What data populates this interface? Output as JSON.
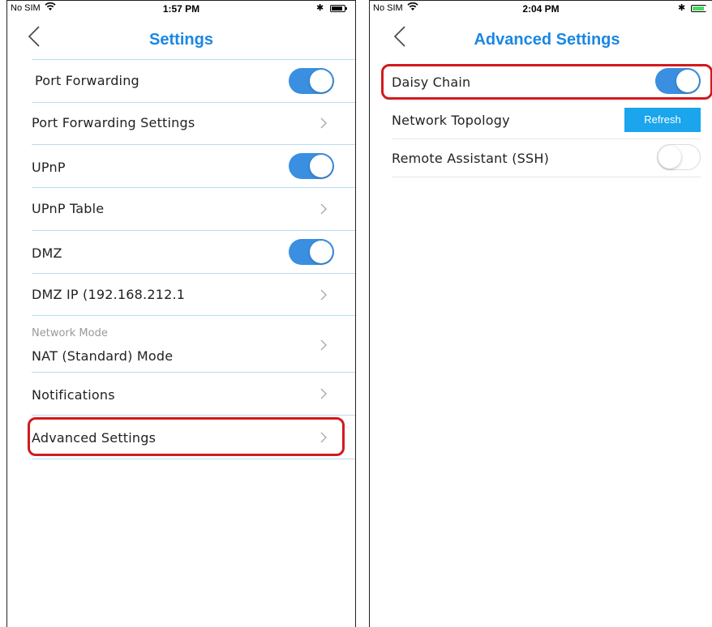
{
  "left": {
    "status": {
      "carrier": "No SIM",
      "time": "1:57 PM"
    },
    "nav": {
      "title": "Settings"
    },
    "rows": {
      "port_forwarding": {
        "label": "Port Forwarding",
        "toggle": "on"
      },
      "port_forwarding_settings": {
        "label": "Port Forwarding Settings"
      },
      "upnp": {
        "label": "UPnP",
        "toggle": "on"
      },
      "upnp_table": {
        "label": "UPnP Table"
      },
      "dmz": {
        "label": "DMZ",
        "toggle": "on"
      },
      "dmz_ip": {
        "label": "DMZ IP (192.168.212.1"
      },
      "network_mode": {
        "sublabel": "Network Mode",
        "label": "NAT (Standard) Mode"
      },
      "notifications": {
        "label": "Notifications"
      },
      "advanced_settings": {
        "label": "Advanced Settings",
        "highlighted": true
      }
    }
  },
  "right": {
    "status": {
      "carrier": "No SIM",
      "time": "2:04 PM"
    },
    "nav": {
      "title": "Advanced Settings"
    },
    "rows": {
      "daisy_chain": {
        "label": "Daisy Chain",
        "toggle": "on",
        "highlighted": true
      },
      "network_topology": {
        "label": "Network Topology",
        "button": "Refresh"
      },
      "remote_assistant": {
        "label": "Remote Assistant (SSH)",
        "toggle": "off"
      }
    }
  },
  "colors": {
    "accent": "#1a87e4",
    "toggle_on": "#3a8fe0",
    "refresh_button": "#1aa5ec",
    "highlight": "#d21a1f",
    "divider": "#b9dbf4"
  }
}
